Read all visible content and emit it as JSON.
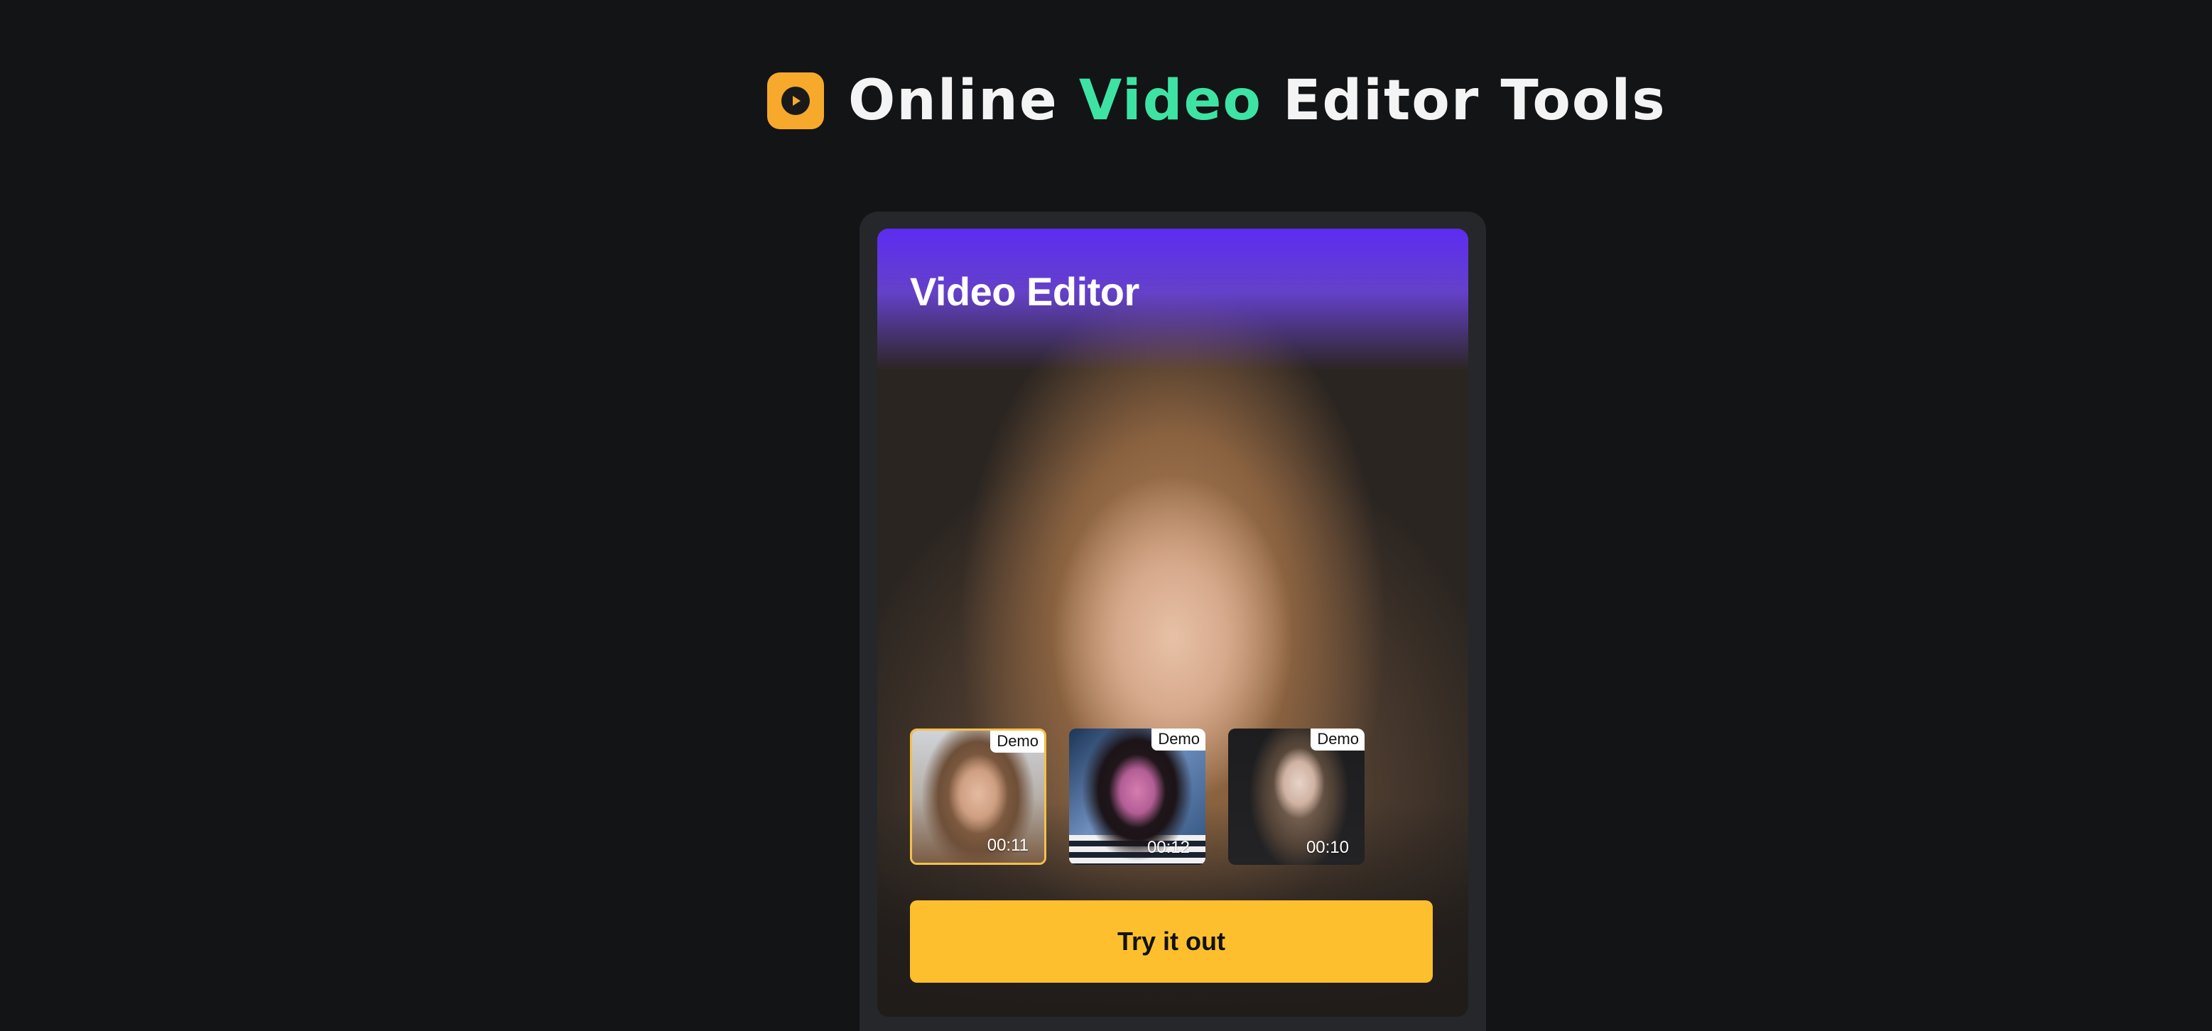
{
  "header": {
    "title_part1": "Online ",
    "title_accent": "Video",
    "title_part2": " Editor Tools",
    "logo_icon": "play-icon"
  },
  "card": {
    "title": "Video Editor",
    "thumbnails": [
      {
        "badge": "Demo",
        "duration": "00:11",
        "selected": true
      },
      {
        "badge": "Demo",
        "duration": "00:12",
        "selected": false
      },
      {
        "badge": "Demo",
        "duration": "00:10",
        "selected": false
      }
    ],
    "cta_label": "Try it out"
  },
  "colors": {
    "background": "#131416",
    "accent_green": "#3ee3a4",
    "logo_orange": "#f6a92b",
    "cta_yellow": "#fdbf2d",
    "card_top_purple": "#5d2cf2",
    "selected_border": "#f4c04d"
  }
}
